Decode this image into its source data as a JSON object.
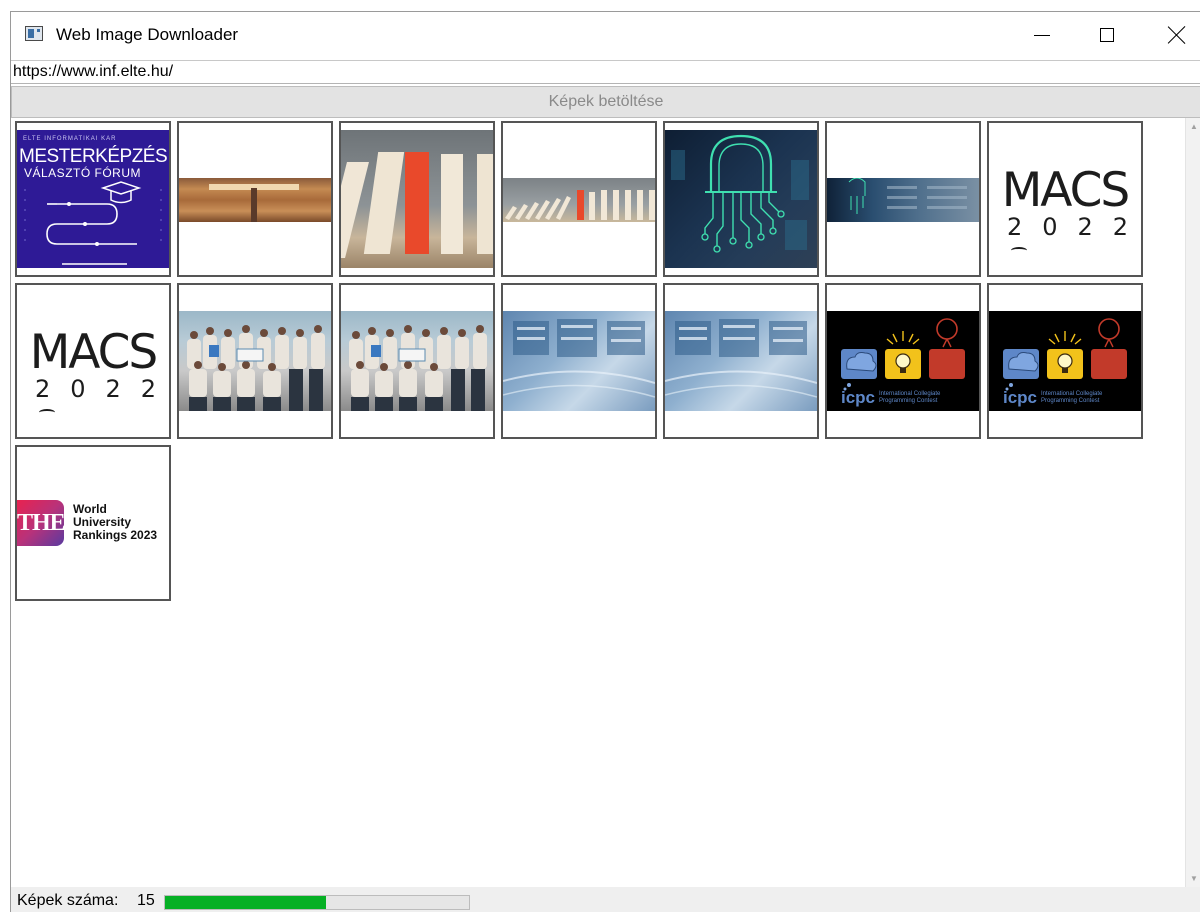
{
  "window": {
    "title": "Web Image Downloader"
  },
  "url_input": {
    "value": "https://www.inf.elte.hu/"
  },
  "load_button": {
    "label": "Képek betöltése"
  },
  "thumbnails": [
    {
      "kind": "forum",
      "header": "ELTE INFORMATIKAI KAR",
      "title": "MESTERKÉPZÉS",
      "subtitle": "VÁLASZTÓ FÓRUM"
    },
    {
      "kind": "auditorium"
    },
    {
      "kind": "dominoes"
    },
    {
      "kind": "domino-row"
    },
    {
      "kind": "lock"
    },
    {
      "kind": "server-strip"
    },
    {
      "kind": "macs",
      "line1": "MACS",
      "line2": "2022"
    },
    {
      "kind": "macs",
      "line1": "MACS",
      "line2": "2022"
    },
    {
      "kind": "team-photo"
    },
    {
      "kind": "team-photo"
    },
    {
      "kind": "datacenter"
    },
    {
      "kind": "datacenter"
    },
    {
      "kind": "icpc",
      "logo": "icpc",
      "caption": "International Collegiate Programming Contest"
    },
    {
      "kind": "icpc",
      "logo": "icpc",
      "caption": "International Collegiate Programming Contest"
    },
    {
      "kind": "the",
      "logo": "THE",
      "line1": "World",
      "line2": "University",
      "line3": "Rankings 2023"
    }
  ],
  "status": {
    "count_label": "Képek száma:",
    "count_value": "15",
    "progress": 0.53,
    "progress_color": "#06b025"
  }
}
